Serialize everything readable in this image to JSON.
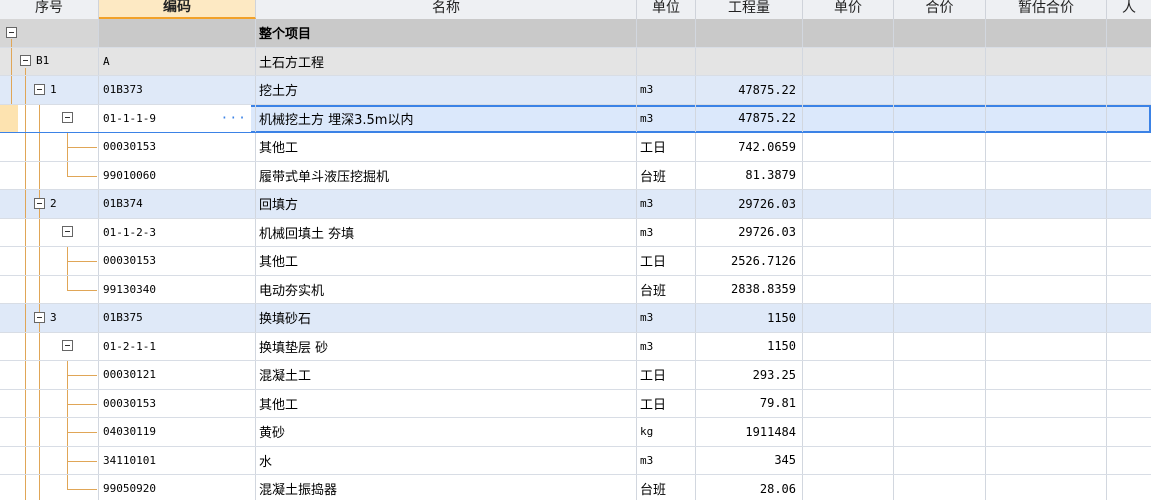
{
  "header": {
    "columns": [
      "序号",
      "编码",
      "名称",
      "单位",
      "工程量",
      "单价",
      "合价",
      "暂估合价",
      "人"
    ]
  },
  "rows": [
    {
      "idx": "",
      "code": "",
      "name": "整个项目",
      "unit": "",
      "qty": ""
    },
    {
      "idx": "B1",
      "code": "A",
      "name": "土石方工程",
      "unit": "",
      "qty": ""
    },
    {
      "idx": "1",
      "code": "01B373",
      "name": "挖土方",
      "unit": "m3",
      "qty": "47875.22"
    },
    {
      "idx": "",
      "code": "01-1-1-9",
      "name": "机械挖土方 埋深3.5m以内",
      "unit": "m3",
      "qty": "47875.22"
    },
    {
      "idx": "",
      "code": "00030153",
      "name": "其他工",
      "unit": "工日",
      "qty": "742.0659"
    },
    {
      "idx": "",
      "code": "99010060",
      "name": "履带式单斗液压挖掘机",
      "unit": "台班",
      "qty": "81.3879"
    },
    {
      "idx": "2",
      "code": "01B374",
      "name": "回填方",
      "unit": "m3",
      "qty": "29726.03"
    },
    {
      "idx": "",
      "code": "01-1-2-3",
      "name": "机械回填土 夯填",
      "unit": "m3",
      "qty": "29726.03"
    },
    {
      "idx": "",
      "code": "00030153",
      "name": "其他工",
      "unit": "工日",
      "qty": "2526.7126"
    },
    {
      "idx": "",
      "code": "99130340",
      "name": "电动夯实机",
      "unit": "台班",
      "qty": "2838.8359"
    },
    {
      "idx": "3",
      "code": "01B375",
      "name": "换填砂石",
      "unit": "m3",
      "qty": "1150"
    },
    {
      "idx": "",
      "code": "01-2-1-1",
      "name": "换填垫层 砂",
      "unit": "m3",
      "qty": "1150"
    },
    {
      "idx": "",
      "code": "00030121",
      "name": "混凝土工",
      "unit": "工日",
      "qty": "293.25"
    },
    {
      "idx": "",
      "code": "00030153",
      "name": "其他工",
      "unit": "工日",
      "qty": "79.81"
    },
    {
      "idx": "",
      "code": "04030119",
      "name": "黄砂",
      "unit": "kg",
      "qty": "1911484"
    },
    {
      "idx": "",
      "code": "34110101",
      "name": "水",
      "unit": "m3",
      "qty": "345"
    },
    {
      "idx": "",
      "code": "99050920",
      "name": "混凝土振捣器",
      "unit": "台班",
      "qty": "28.06"
    }
  ],
  "colors": {
    "selected_outline": "#3b82e6",
    "section_blue": "#dfe9f8",
    "header_active": "#fde9c3",
    "tree_line": "#e0a657"
  }
}
